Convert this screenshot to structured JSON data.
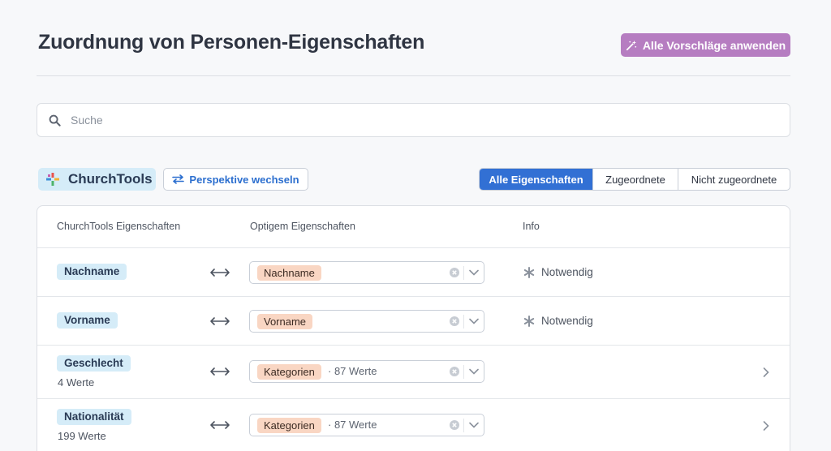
{
  "header": {
    "title": "Zuordnung von Personen-Eigenschaften",
    "apply_all_label": "Alle Vorschläge anwenden"
  },
  "search": {
    "placeholder": "Suche",
    "value": ""
  },
  "toolbar": {
    "source_label": "ChurchTools",
    "switch_label": "Perspektive wechseln",
    "filters": [
      {
        "label": "Alle Eigenschaften",
        "active": true
      },
      {
        "label": "Zugeordnete",
        "active": false
      },
      {
        "label": "Nicht zugeordnete",
        "active": false
      }
    ]
  },
  "table": {
    "headers": [
      "ChurchTools Eigenschaften",
      "Optigem Eigenschaften",
      "Info"
    ],
    "rows": [
      {
        "source": "Nachname",
        "source_sub": "",
        "target": "Nachname",
        "target_extra": "",
        "info": "Notwendig"
      },
      {
        "source": "Vorname",
        "source_sub": "",
        "target": "Vorname",
        "target_extra": "",
        "info": "Notwendig"
      },
      {
        "source": "Geschlecht",
        "source_sub": "4 Werte",
        "target": "Kategorien",
        "target_extra": "· 87 Werte",
        "info": ""
      },
      {
        "source": "Nationalität",
        "source_sub": "199 Werte",
        "target": "Kategorien",
        "target_extra": "· 87 Werte",
        "info": ""
      }
    ]
  },
  "colors": {
    "accent_blue": "#3270d4",
    "apply_purple": "#b67dc1",
    "source_tag": "#d5ecf8",
    "target_chip": "#f9d6c3"
  }
}
